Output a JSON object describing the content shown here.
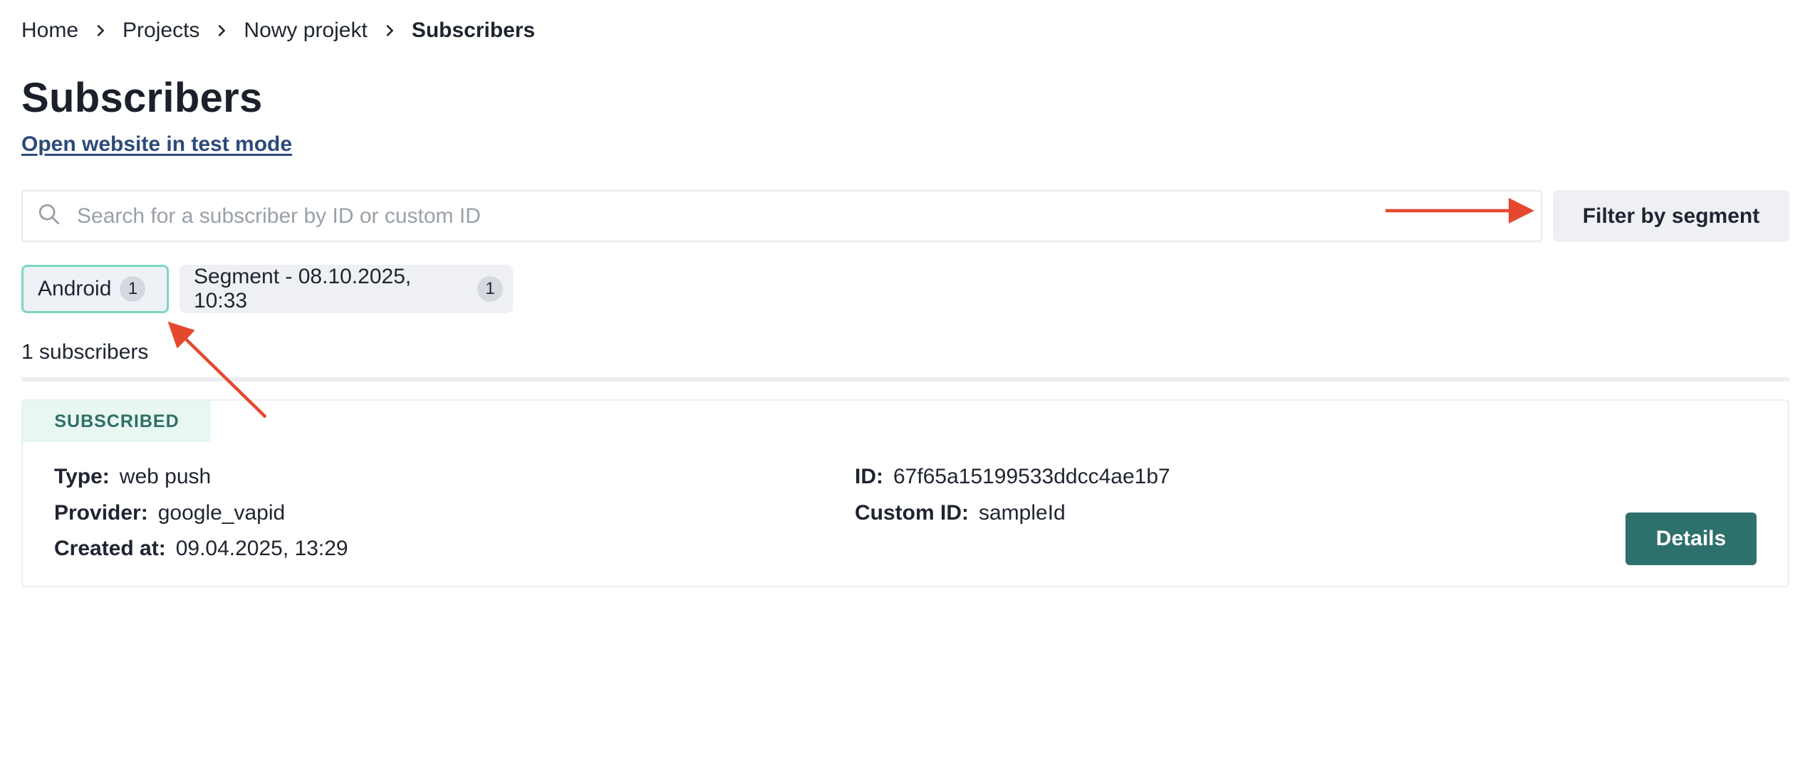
{
  "breadcrumb": {
    "items": [
      "Home",
      "Projects",
      "Nowy projekt",
      "Subscribers"
    ]
  },
  "page": {
    "title": "Subscribers",
    "test_link": "Open website in test mode"
  },
  "search": {
    "placeholder": "Search for a subscriber by ID or custom ID",
    "value": ""
  },
  "filter_button": "Filter by segment",
  "chips": [
    {
      "label": "Android",
      "count": "1",
      "active": true
    },
    {
      "label": "Segment - 08.10.2025, 10:33",
      "count": "1",
      "active": false
    }
  ],
  "subscriber_count": "1 subscribers",
  "subscriber": {
    "status": "SUBSCRIBED",
    "type_label": "Type:",
    "type_value": "web push",
    "provider_label": "Provider:",
    "provider_value": "google_vapid",
    "created_label": "Created at:",
    "created_value": "09.04.2025, 13:29",
    "id_label": "ID:",
    "id_value": "67f65a15199533ddcc4ae1b7",
    "custom_id_label": "Custom ID:",
    "custom_id_value": "sampleId",
    "details_button": "Details"
  },
  "colors": {
    "accent": "#2e706b",
    "chip_active_border": "#7ed6c2",
    "status_bg": "#e8f7f1",
    "annotation_arrow": "#e5482f",
    "link": "#2d4a7a"
  },
  "icons": {
    "search": "search-icon",
    "breadcrumb_separator": "chevron-right-icon"
  }
}
